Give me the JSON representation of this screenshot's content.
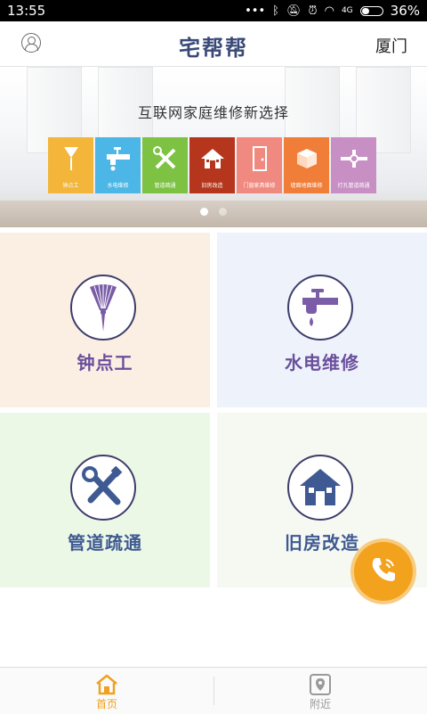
{
  "status_bar": {
    "time": "13:55",
    "network_label": "4G",
    "battery_percent": "36%",
    "battery_level": 0.36
  },
  "header": {
    "title": "宅帮帮",
    "city": "厦门"
  },
  "banner": {
    "tagline": "互联网家庭维修新选择",
    "tiles": [
      {
        "label": "钟点工",
        "color": "#f3b53a",
        "icon": "broom-icon"
      },
      {
        "label": "水电维修",
        "color": "#4cb6e6",
        "icon": "faucet-icon"
      },
      {
        "label": "管道疏通",
        "color": "#7dc243",
        "icon": "tools-icon"
      },
      {
        "label": "旧房改造",
        "color": "#b5361d",
        "icon": "house-icon"
      },
      {
        "label": "门窗家具维修",
        "color": "#f08a80",
        "icon": "door-icon"
      },
      {
        "label": "墙面地面维修",
        "color": "#f07d38",
        "icon": "wall-icon"
      },
      {
        "label": "打孔管道疏通",
        "color": "#c88fc4",
        "icon": "drill-icon"
      }
    ],
    "page_count": 2,
    "active_page": 1
  },
  "services": [
    {
      "label": "钟点工",
      "icon": "broom-icon"
    },
    {
      "label": "水电维修",
      "icon": "faucet-icon"
    },
    {
      "label": "管道疏通",
      "icon": "tools-icon"
    },
    {
      "label": "旧房改造",
      "icon": "house-icon"
    }
  ],
  "colors": {
    "brand": "#3a4a78",
    "accent": "#f0a020"
  },
  "bottom_nav": {
    "home": "首页",
    "nearby": "附近"
  }
}
